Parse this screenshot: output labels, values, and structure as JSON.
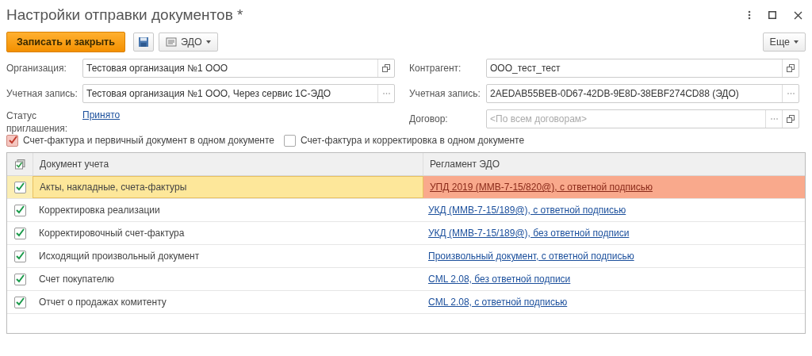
{
  "window": {
    "title": "Настройки отправки документов *"
  },
  "toolbar": {
    "primary": "Записать и закрыть",
    "edo": "ЭДО",
    "more": "Еще"
  },
  "left_fields": [
    {
      "label": "Организация:",
      "value": "Тестовая организация №1 ООО",
      "kind": "open"
    },
    {
      "label": "Учетная запись:",
      "value": "Тестовая организация №1 ООО, Через сервис 1С-ЭДО",
      "kind": "choice"
    }
  ],
  "invitation": {
    "label": "Статус приглашения:",
    "link": "Принято"
  },
  "right_fields": [
    {
      "label": "Контрагент:",
      "value": "ООО_тест_тест",
      "kind": "open"
    },
    {
      "label": "Учетная запись:",
      "value": "2AEDAB55BEB-0D67-42DB-9E8D-38EBF274CD88 (ЭДО)",
      "kind": "choice"
    },
    {
      "label": "Договор:",
      "placeholder": "<По всем договорам>",
      "kind": "both"
    }
  ],
  "options": [
    {
      "label": "Счет-фактура и первичный документ в одном документе",
      "checked": true
    },
    {
      "label": "Счет-фактура и корректировка в одном документе",
      "checked": false
    }
  ],
  "table": {
    "columns": [
      "Документ учета",
      "Регламент ЭДО"
    ],
    "rows": [
      {
        "checked": true,
        "selected": true,
        "document": "Акты, накладные, счета-фактуры",
        "regulation": "УПД 2019 (ММВ-7-15/820@), с ответной подписью"
      },
      {
        "checked": true,
        "selected": false,
        "document": "Корректировка реализации",
        "regulation": "УКД (ММВ-7-15/189@), с ответной подписью"
      },
      {
        "checked": true,
        "selected": false,
        "document": "Корректировочный счет-фактура",
        "regulation": "УКД (ММВ-7-15/189@), без ответной подписи"
      },
      {
        "checked": true,
        "selected": false,
        "document": "Исходящий произвольный документ",
        "regulation": "Произвольный документ, с ответной подписью"
      },
      {
        "checked": true,
        "selected": false,
        "document": "Счет покупателю",
        "regulation": "CML 2.08, без ответной подписи"
      },
      {
        "checked": true,
        "selected": false,
        "document": "Отчет о продажах комитенту",
        "regulation": "CML 2.08, с ответной подписью"
      }
    ]
  }
}
